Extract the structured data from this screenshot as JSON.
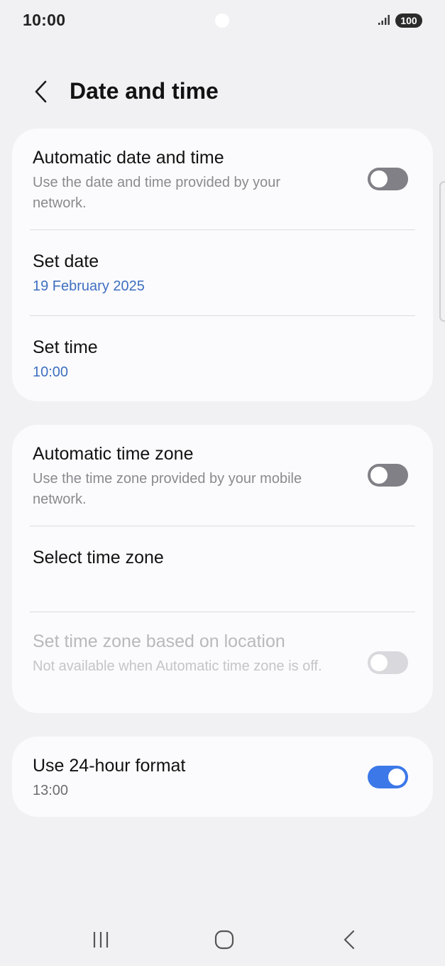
{
  "status_bar": {
    "time": "10:00",
    "battery": "100"
  },
  "header": {
    "title": "Date and time"
  },
  "card1": {
    "auto_date_time": {
      "title": "Automatic date and time",
      "subtitle": "Use the date and time provided by your network.",
      "toggle": "off"
    },
    "set_date": {
      "title": "Set date",
      "value": "19 February 2025"
    },
    "set_time": {
      "title": "Set time",
      "value": "10:00"
    }
  },
  "card2": {
    "auto_time_zone": {
      "title": "Automatic time zone",
      "subtitle": "Use the time zone provided by your mobile network.",
      "toggle": "off"
    },
    "select_time_zone": {
      "title": "Select time zone"
    },
    "location_time_zone": {
      "title": "Set time zone based on location",
      "subtitle": "Not available when Automatic time zone is off.",
      "toggle": "disabled"
    }
  },
  "card3": {
    "use_24_hour": {
      "title": "Use 24-hour format",
      "value": "13:00",
      "toggle": "on"
    }
  },
  "colors": {
    "accent": "#3c78e8",
    "value_blue": "#3e6fc0",
    "background": "#f1f1f3",
    "card": "#fbfbfd"
  },
  "icons": {
    "back": "chevron-left-icon",
    "signal": "signal-bars-icon",
    "nav_recents": "recents-icon",
    "nav_home": "home-icon",
    "nav_back": "nav-back-icon"
  }
}
